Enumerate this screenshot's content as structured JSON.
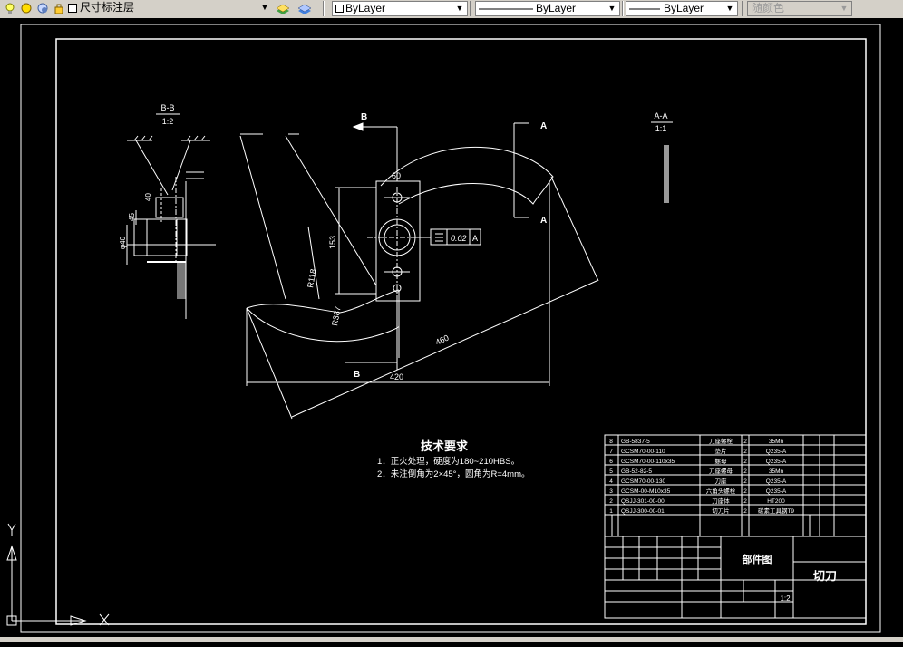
{
  "toolbar": {
    "layer_name": "尺寸标注层",
    "color_label": "ByLayer",
    "linetype_label": "ByLayer",
    "lineweight_label": "ByLayer",
    "plotstyle_label": "随颜色"
  },
  "drawing": {
    "section_bb_label": "B-B",
    "section_bb_scale": "1:2",
    "section_aa_label": "A-A",
    "section_aa_scale": "1:1",
    "cut_label_a_top": "A",
    "cut_label_a_bottom": "A",
    "cut_label_b_top": "B",
    "cut_label_b_bottom": "B",
    "dim_60": "60",
    "dim_420": "420",
    "dim_460": "460",
    "dim_153": "153",
    "dim_r118": "R118",
    "dim_r387": "R387",
    "dim_40": "40",
    "dim_45": "45",
    "dim_phi40": "φ40",
    "tolerance_value": "0.02",
    "tolerance_datum": "A",
    "notes_title": "技术要求",
    "note_1": "1．正火处理，硬度为180~210HBS。",
    "note_2": "2．未注倒角为2×45°，圆角为R=4mm。"
  },
  "title_block": {
    "drawing_type": "部件图",
    "part_name": "切刀",
    "scale": "1:2",
    "bom_rows": [
      {
        "no": "8",
        "code": "GB-5837-5",
        "name": "刀座螺栓",
        "qty": "2",
        "mat": "35Mn"
      },
      {
        "no": "7",
        "code": "GCSM70-00-110",
        "name": "垫片",
        "qty": "2",
        "mat": "Q235-A"
      },
      {
        "no": "6",
        "code": "GCSM70-00-110x35",
        "name": "螺母",
        "qty": "2",
        "mat": "Q235-A"
      },
      {
        "no": "5",
        "code": "GB-52-82-5",
        "name": "刀座螺母",
        "qty": "2",
        "mat": "35Mn"
      },
      {
        "no": "4",
        "code": "GCSM70-00-130",
        "name": "刀座",
        "qty": "2",
        "mat": "Q235-A"
      },
      {
        "no": "3",
        "code": "GCSM-00-M10x35",
        "name": "六角头螺栓",
        "qty": "2",
        "mat": "Q235-A"
      },
      {
        "no": "2",
        "code": "QSJJ-301-00-00",
        "name": "刀座体",
        "qty": "2",
        "mat": "HT200"
      },
      {
        "no": "1",
        "code": "QSJJ-300-00-01",
        "name": "切刀片",
        "qty": "2",
        "mat": "碳素工具钢T9"
      }
    ]
  }
}
